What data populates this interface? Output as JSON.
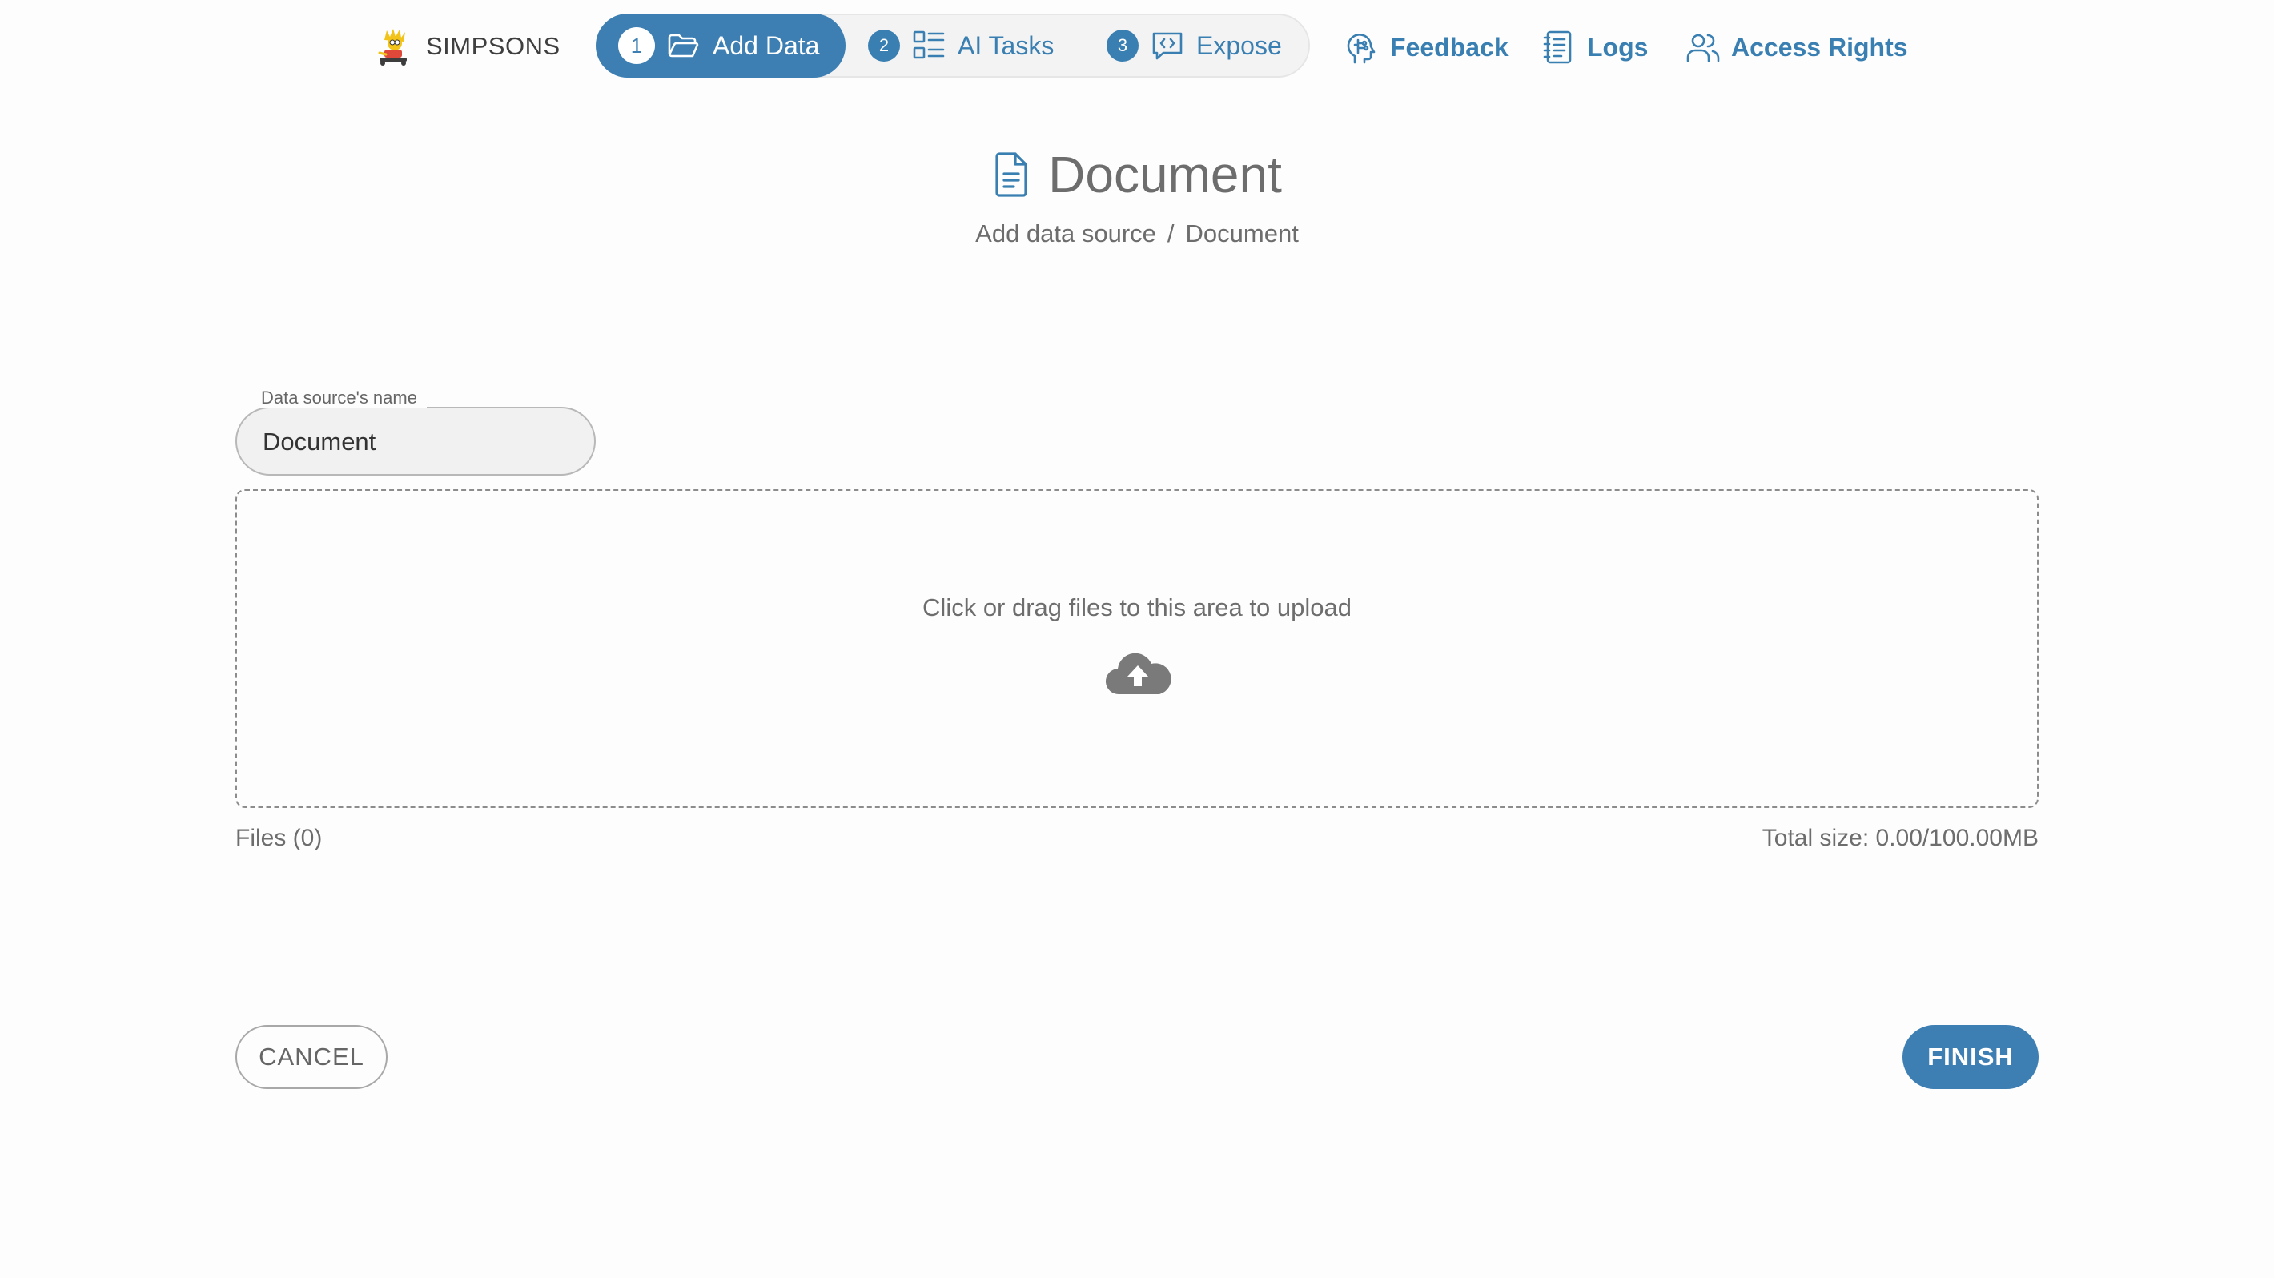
{
  "brand": {
    "name": "SIMPSONS",
    "logo_icon": "cartoon-character-logo"
  },
  "stepper": {
    "steps": [
      {
        "number": "1",
        "label": "Add Data",
        "icon": "folder-open-icon",
        "active": true
      },
      {
        "number": "2",
        "label": "AI Tasks",
        "icon": "list-grid-icon",
        "active": false
      },
      {
        "number": "3",
        "label": "Expose",
        "icon": "chat-code-icon",
        "active": false
      }
    ]
  },
  "nav": {
    "feedback": {
      "label": "Feedback",
      "icon": "head-brain-icon"
    },
    "logs": {
      "label": "Logs",
      "icon": "notebook-icon"
    },
    "access_rights": {
      "label": "Access Rights",
      "icon": "users-icon"
    }
  },
  "page": {
    "title": "Document",
    "title_icon": "document-icon",
    "breadcrumb": [
      "Add data source",
      "Document"
    ],
    "breadcrumb_separator": "/"
  },
  "form": {
    "name_label": "Data source's name",
    "name_value": "Document"
  },
  "upload": {
    "prompt": "Click or drag files to this area to upload",
    "icon": "cloud-upload-icon",
    "files_count": "Files (0)",
    "total_size": "Total size: 0.00/100.00MB"
  },
  "actions": {
    "cancel_label": "CANCEL",
    "finish_label": "FINISH"
  },
  "colors": {
    "accent": "#3d7fb3",
    "text_muted": "#6d6d6d",
    "background": "#fdfdfd"
  }
}
